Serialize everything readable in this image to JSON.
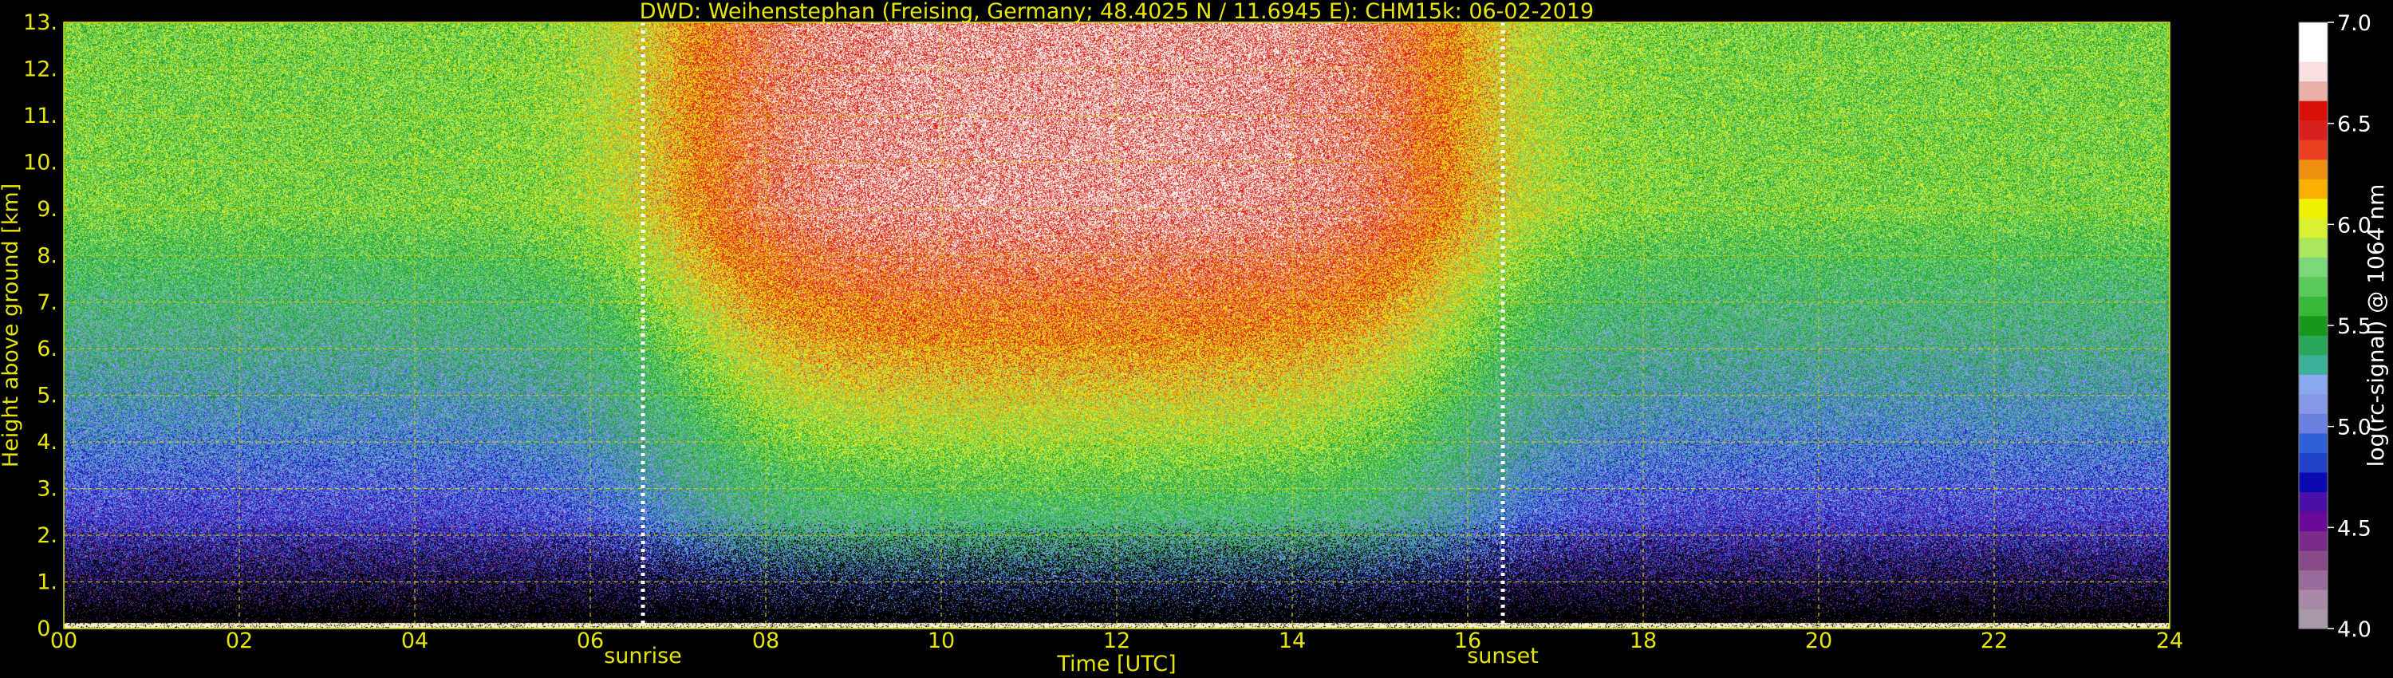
{
  "chart_data": {
    "type": "heatmap",
    "title": "DWD: Weihenstephan (Freising, Germany; 48.4025 N / 11.6945 E):    CHM15k: 06-02-2019",
    "xlabel": "Time [UTC]",
    "ylabel": "Height above ground [km]",
    "xlim": [
      0,
      24
    ],
    "ylim": [
      0,
      13
    ],
    "x_ticks": [
      "00",
      "02",
      "04",
      "06",
      "08",
      "10",
      "12",
      "14",
      "16",
      "18",
      "20",
      "22",
      "24"
    ],
    "y_ticks": [
      "0.",
      "1.",
      "2.",
      "3.",
      "4.",
      "5.",
      "6.",
      "7.",
      "8.",
      "9.",
      "10.",
      "11.",
      "12.",
      "13."
    ],
    "grid": true,
    "events": [
      {
        "label": "sunrise",
        "time": 6.6
      },
      {
        "label": "sunset",
        "time": 16.4
      }
    ],
    "colorbar": {
      "label": "log(rc-signal) @ 1064 nm",
      "range": [
        4.0,
        7.0
      ],
      "tick_labels": [
        "4.0",
        "4.5",
        "5.0",
        "5.5",
        "6.0",
        "6.5",
        "7.0"
      ],
      "colors": [
        "#a898a8",
        "#a88aa8",
        "#9a6a9a",
        "#884a88",
        "#7a2a88",
        "#6a0a98",
        "#4a10a8",
        "#0a0ab0",
        "#2040c8",
        "#3060d8",
        "#6a80e0",
        "#8898e8",
        "#8aa8f0",
        "#3ab098",
        "#28a858",
        "#18981a",
        "#38b838",
        "#5ac85a",
        "#7ad87a",
        "#a8e85a",
        "#d8f030",
        "#f0f000",
        "#f8b000",
        "#f09010",
        "#e84020",
        "#d82020",
        "#d81008",
        "#e8b0a8",
        "#f8e0e0",
        "#ffffff",
        "#ffffff"
      ]
    },
    "profile_model": {
      "night_level_surface": 4.5,
      "night_level_top": 5.75,
      "day_level_low": 5.0,
      "day_level_top": 6.7
    }
  }
}
